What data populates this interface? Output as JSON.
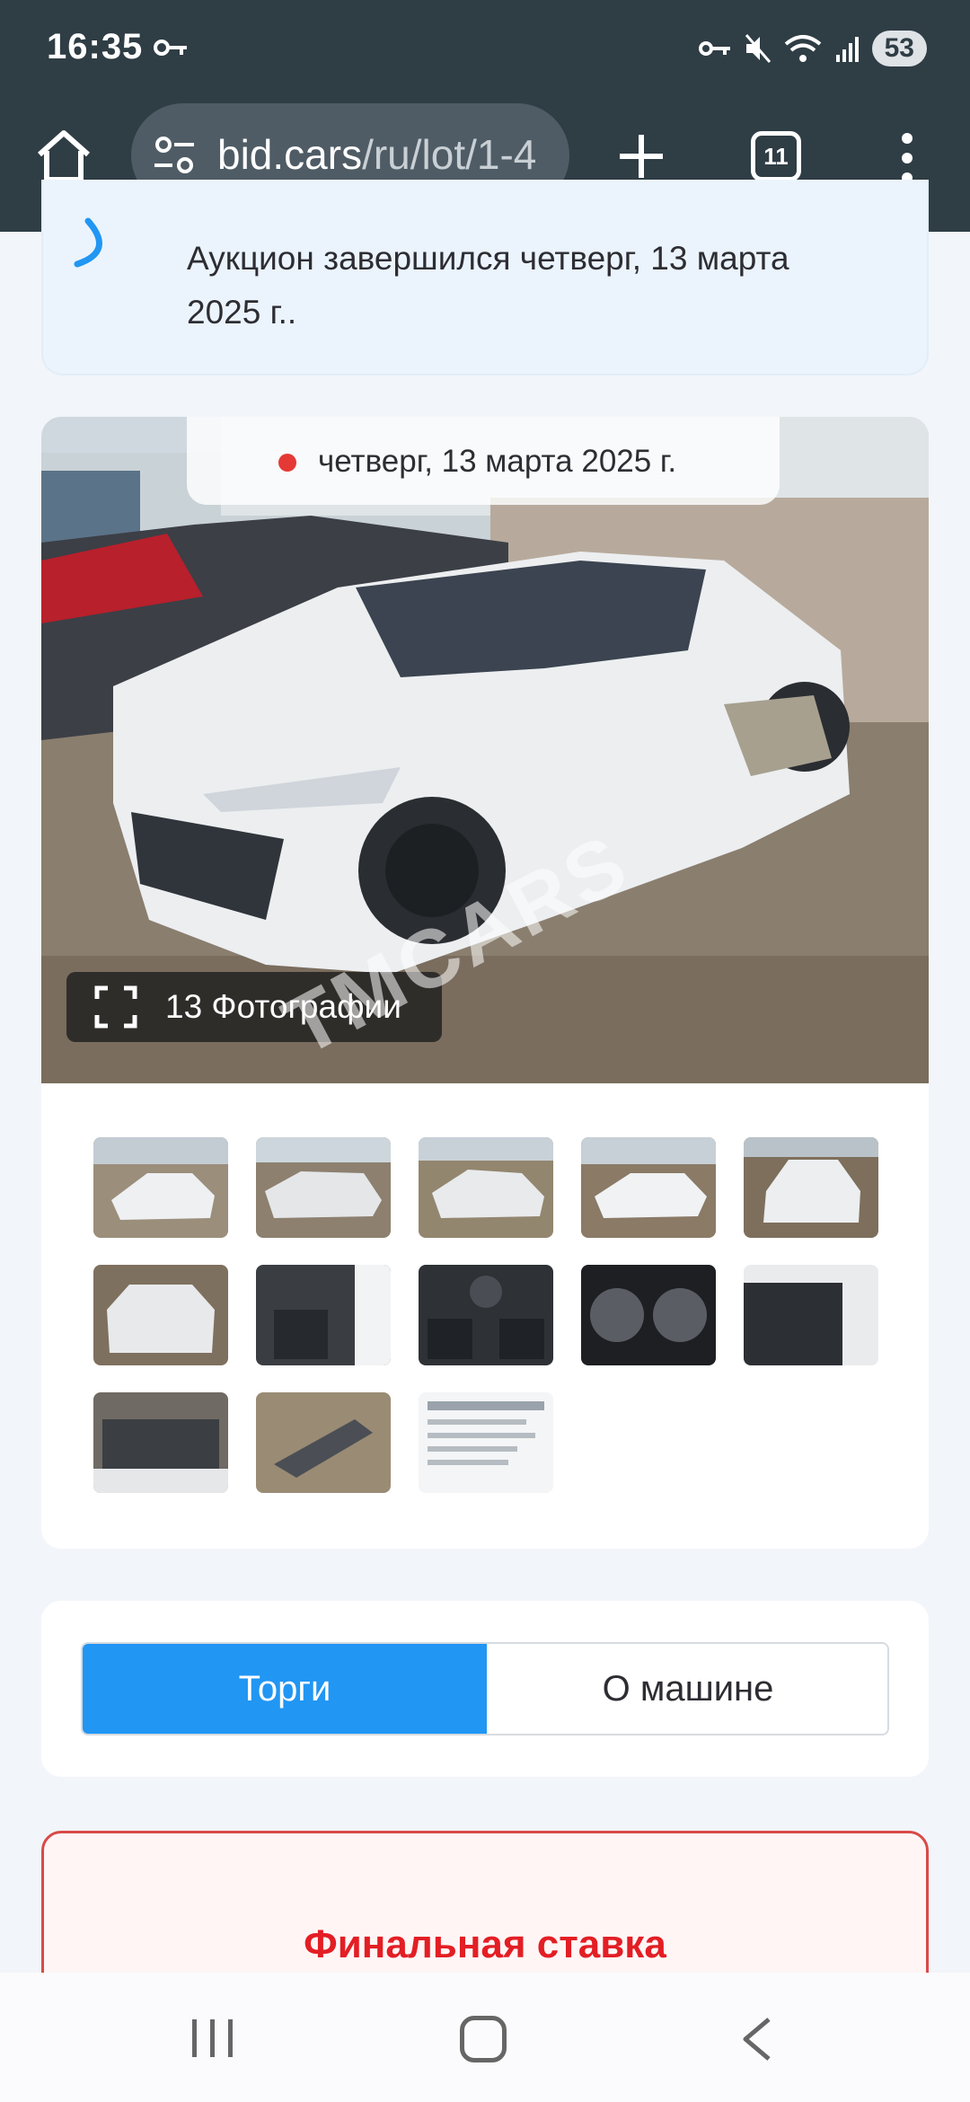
{
  "status_bar": {
    "time": "16:35",
    "battery": "53"
  },
  "browser": {
    "url_domain": "bid.cars",
    "url_path": "/ru/lot/1-4",
    "tab_count": "11"
  },
  "auction_info": {
    "text": "Аукцион завершился четверг, 13 марта 2025 г.."
  },
  "gallery": {
    "date_label": "четверг, 13 марта 2025 г.",
    "photos_label": "13 Фотографии",
    "watermark": "TMCARS"
  },
  "tabs": {
    "bids_label": "Торги",
    "about_label": "О машине"
  },
  "bid": {
    "title": "Финальная ставка"
  },
  "colors": {
    "chrome": "#2f3d45",
    "accent": "#2196f3",
    "bid_red": "#e31e24"
  }
}
